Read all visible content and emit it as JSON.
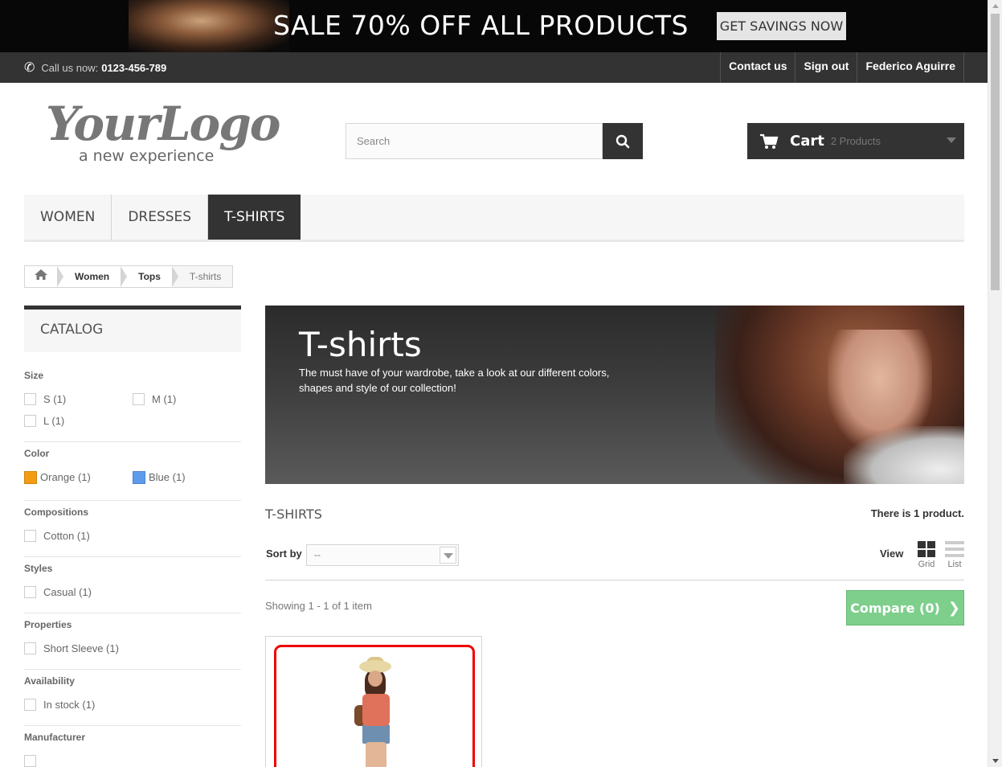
{
  "promo": {
    "text": "SALE 70% OFF ALL PRODUCTS",
    "button": "GET SAVINGS NOW"
  },
  "topnav": {
    "phone_label": "Call us now:",
    "phone_number": "0123-456-789",
    "links": [
      "Contact us",
      "Sign out",
      "Federico Aguirre"
    ]
  },
  "logo": {
    "main": "YourLogo",
    "sub": "a new experience"
  },
  "search": {
    "placeholder": "Search"
  },
  "cart": {
    "label": "Cart",
    "count": "2 Products"
  },
  "menu": {
    "items": [
      "WOMEN",
      "DRESSES",
      "T-SHIRTS"
    ],
    "active": "T-SHIRTS"
  },
  "breadcrumb": [
    "Women",
    "Tops",
    "T-shirts"
  ],
  "sidebar": {
    "title": "CATALOG",
    "facets": {
      "size": {
        "title": "Size",
        "options": [
          "S (1)",
          "M (1)",
          "L (1)"
        ]
      },
      "color": {
        "title": "Color",
        "options": [
          {
            "label": "Orange (1)",
            "color": "#F39C11"
          },
          {
            "label": "Blue (1)",
            "color": "#5D9CEC"
          }
        ]
      },
      "compositions": {
        "title": "Compositions",
        "options": [
          "Cotton (1)"
        ]
      },
      "styles": {
        "title": "Styles",
        "options": [
          "Casual (1)"
        ]
      },
      "properties": {
        "title": "Properties",
        "options": [
          "Short Sleeve (1)"
        ]
      },
      "availability": {
        "title": "Availability",
        "options": [
          "In stock (1)"
        ]
      },
      "manufacturer": {
        "title": "Manufacturer"
      }
    }
  },
  "category": {
    "title": "T-shirts",
    "description": "The must have of your wardrobe, take a look at our different colors, shapes and style of our collection!"
  },
  "listing": {
    "heading": "T-SHIRTS",
    "count_text": "There is 1 product.",
    "sort_label": "Sort by",
    "sort_value": "--",
    "view_label": "View",
    "view_grid": "Grid",
    "view_list": "List",
    "showing": "Showing 1 - 1 of 1 item",
    "compare": "Compare (0)"
  },
  "colors": {
    "dark": "#333333",
    "compare_green": "#7ECF8C",
    "highlight_red": "#EE0000"
  }
}
